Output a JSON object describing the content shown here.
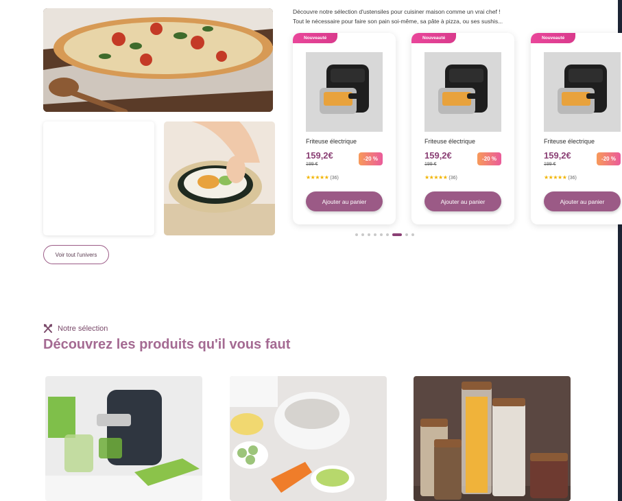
{
  "intro": {
    "line1": "Découvre notre sélection d'ustensiles pour cuisiner maison comme un vrai chef !",
    "line2": "Tout le nécessaire pour faire son pain soi-même, sa pâte à pizza, ou ses sushis..."
  },
  "gallery": {
    "voir_btn": "Voir tout l'univers"
  },
  "products": [
    {
      "badge": "Nouveauté",
      "name": "Friteuse électrique",
      "price": "159,2€",
      "old_price": "199 €",
      "discount": "-20 %",
      "stars": "★★★★★",
      "reviews": "(36)",
      "cta": "Ajouter au panier"
    },
    {
      "badge": "Nouveauté",
      "name": "Friteuse électrique",
      "price": "159,2€",
      "old_price": "199 €",
      "discount": "-20 %",
      "stars": "★★★★★",
      "reviews": "(36)",
      "cta": "Ajouter au panier"
    },
    {
      "badge": "Nouveauté",
      "name": "Friteuse électrique",
      "price": "159,2€",
      "old_price": "199 €",
      "discount": "-20 %",
      "stars": "★★★★★",
      "reviews": "(36)",
      "cta": "Ajouter au panier"
    }
  ],
  "carousel": {
    "dot_count": 9,
    "active_index": 6
  },
  "selection": {
    "tag": "Notre sélection",
    "title": "Découvrez les produits qu'il vous faut",
    "icon": "utensils-icon"
  },
  "colors": {
    "accent": "#9b5a86",
    "badge": "#e9469a",
    "title": "#a46a92"
  }
}
